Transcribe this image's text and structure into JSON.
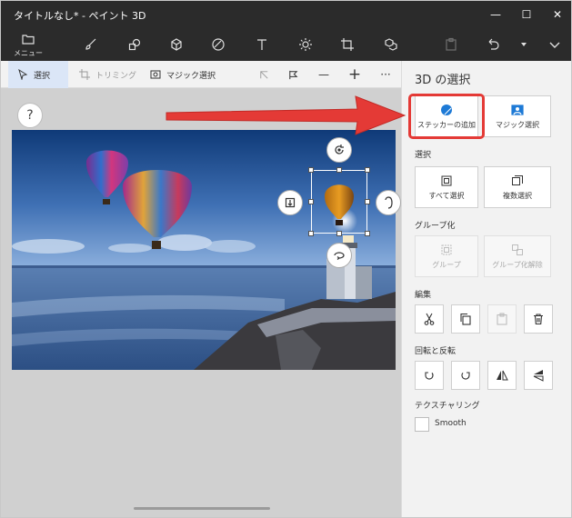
{
  "window": {
    "title": "タイトルなし* - ペイント 3D",
    "minimize": "—",
    "maximize": "☐",
    "close": "✕"
  },
  "toolbar": {
    "menu_label": "メニュー",
    "tools": [
      "brush-icon",
      "2d-shapes-icon",
      "3d-shapes-icon",
      "stickers-icon",
      "text-icon",
      "effects-icon",
      "canvas-icon",
      "3d-library-icon",
      "paste-icon",
      "undo-icon",
      "history-icon",
      "expand-icon"
    ]
  },
  "subbar": {
    "select_label": "選択",
    "crop_label": "トリミング",
    "magic_select_label": "マジック選択",
    "zoom_out": "—",
    "zoom_in": "+",
    "more": "···"
  },
  "workspace": {
    "help": "?"
  },
  "panel": {
    "title": "3D の選択",
    "add_sticker": "ステッカーの追加",
    "magic_select": "マジック選択",
    "section_select": "選択",
    "select_all": "すべて選択",
    "multi_select": "複数選択",
    "section_group": "グループ化",
    "group": "グループ",
    "ungroup": "グループ化解除",
    "section_edit": "編集",
    "section_rotate": "回転と反転",
    "section_texturing": "テクスチャリング",
    "smooth": "Smooth"
  },
  "colors": {
    "titlebar": "#2b2b2b",
    "accent_highlight": "#e43a36",
    "selected_tool": "#dbe6f7",
    "panel_title": "#333333"
  }
}
